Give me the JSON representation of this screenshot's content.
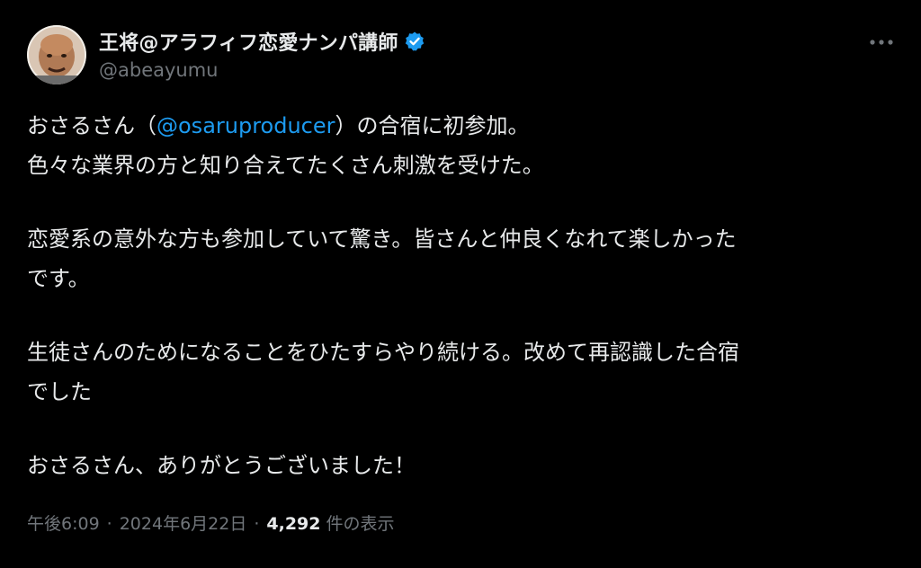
{
  "author": {
    "display_name": "王将@アラフィフ恋愛ナンパ講師",
    "handle": "@abeayumu",
    "verified_icon": "verified-badge-icon",
    "accent_color": "#1d9bf0"
  },
  "more_icon": "more-options-icon",
  "body": {
    "line1_before": "おさるさん（",
    "mention": "@osaruproducer",
    "line1_after": "）の合宿に初参加。",
    "line2": "色々な業界の方と知り合えてたくさん刺激を受けた。",
    "line3": "恋愛系の意外な方も参加していて驚き。皆さんと仲良くなれて楽しかった",
    "line4": "です。",
    "line5": "生徒さんのためになることをひたすらやり続ける。改めて再認識した合宿",
    "line6": "でした",
    "line7": "おさるさん、ありがとうございました！"
  },
  "meta": {
    "time": "午後6:09",
    "separator": "·",
    "date": "2024年6月22日",
    "views_count": "4,292",
    "views_label": "件の表示"
  }
}
